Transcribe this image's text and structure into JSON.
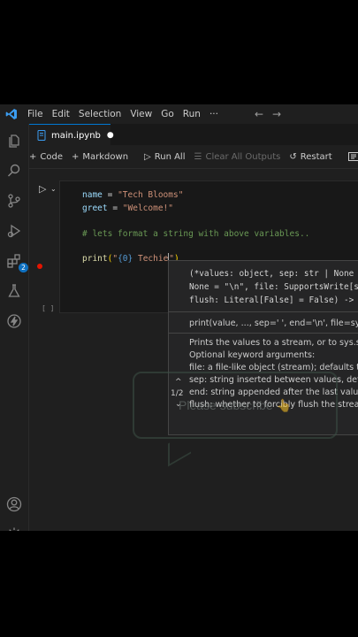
{
  "menu": {
    "file": "File",
    "edit": "Edit",
    "selection": "Selection",
    "view": "View",
    "go": "Go",
    "run": "Run",
    "more": "···",
    "back": "←",
    "forward": "→"
  },
  "activity_bar": {
    "icons": [
      "explorer-icon",
      "search-icon",
      "source-control-icon",
      "run-debug-icon",
      "extensions-icon",
      "testing-icon",
      "remote-icon"
    ],
    "extensions_badge": "2",
    "bottom_icons": [
      "accounts-icon",
      "manage-gear-icon"
    ]
  },
  "tab": {
    "filename": "main.ipynb",
    "dirty_dot": "●"
  },
  "toolbar": {
    "code": "Code",
    "markdown": "Markdown",
    "run_all": "Run All",
    "clear_outputs": "Clear All Outputs",
    "restart": "Restart"
  },
  "cell": {
    "exec_count": "[ ]",
    "lines": {
      "l1_var": "name",
      "l1_op": " = ",
      "l1_str": "\"Tech Blooms\"",
      "l2_var": "greet",
      "l2_op": " = ",
      "l2_str": "\"Welcome!\"",
      "l3_comment": "# lets format a string with above variables..",
      "l4_fn": "print",
      "l4_open": "(",
      "l4_str_a": "\"",
      "l4_brace": "{0}",
      "l4_str_b": " Techie",
      "l4_close": ")"
    }
  },
  "hover": {
    "sig1": "(*values: object, sep: str | None",
    "sig2": "None = \"\\n\", file: SupportsWrite[s",
    "sig3": "flush: Literal[False] = False) ->",
    "call": "print(value, ..., sep=' ', end='\\n', file=sys.st",
    "doc1": "Prints the values to a stream, or to sys.stdo",
    "doc2": "Optional keyword arguments:",
    "doc3": "file: a file-like object (stream); defaults to t",
    "doc4": "sep: string inserted between values, defau",
    "doc5": "end: string appended after the last value,",
    "doc6": "flush: whether to forcibly flush the stream.",
    "pager": "1/2"
  },
  "overlay": {
    "subscribe": "Please subscribe 👆"
  },
  "colors": {
    "editor_bg": "#1f1f1f",
    "accent": "#0078d4",
    "breakpoint": "#e51400"
  }
}
